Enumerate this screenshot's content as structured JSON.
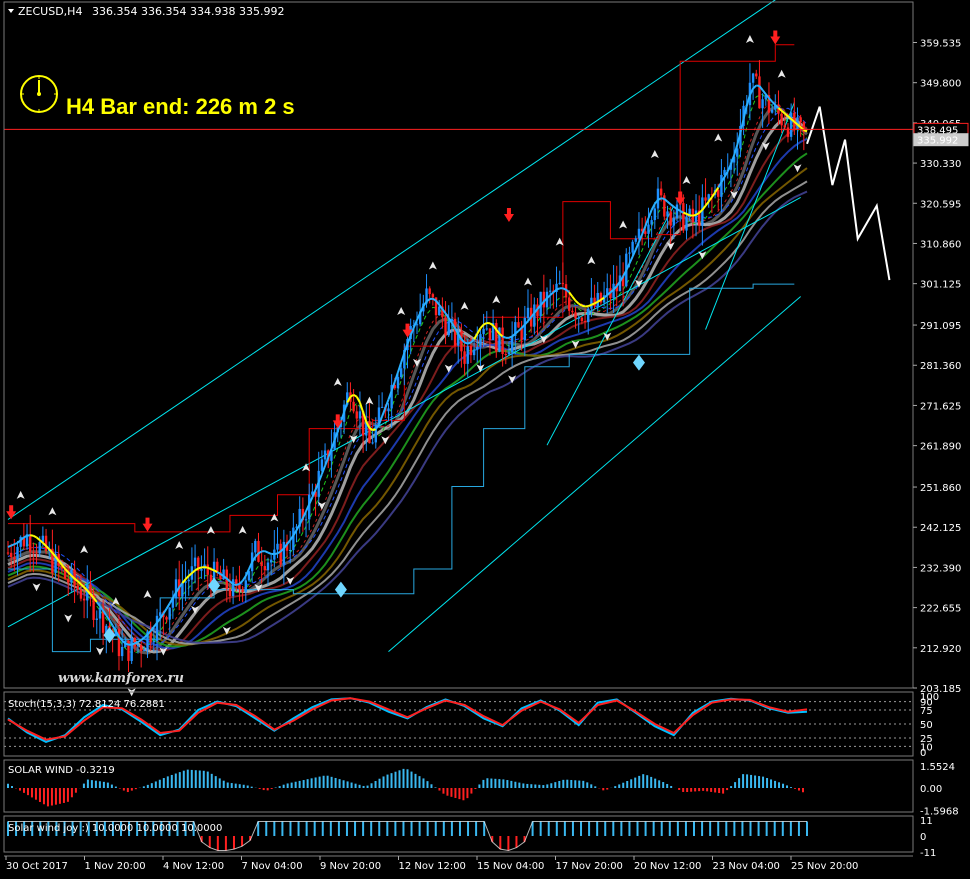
{
  "header": {
    "symbol": "ZECUSD,H4",
    "ohlc": "336.354 336.354 334.938 335.992",
    "timer": "H4 Bar end: 226 m 2 s",
    "watermark": "www.kamforex.ru"
  },
  "colors": {
    "background": "#000000",
    "bull": "#1e90ff",
    "bear": "#ff2020",
    "channel": "#00e5ee",
    "donchian_upper": "#e00000",
    "donchian_lower": "#28a8e0",
    "yellow": "#ffff00",
    "projection": "#ffffff"
  },
  "chart_data": [
    {
      "type": "candlestick",
      "name": "main",
      "ylim": [
        203.185,
        364.5
      ],
      "y_ticks": [
        "359.535",
        "349.800",
        "340.065",
        "330.330",
        "320.595",
        "310.860",
        "301.125",
        "291.095",
        "281.360",
        "271.625",
        "261.890",
        "251.860",
        "242.125",
        "232.390",
        "222.655",
        "212.920",
        "203.185"
      ],
      "price_lines": [
        {
          "label": "338.495",
          "value": 338.495,
          "color": "#ff2020"
        },
        {
          "label": "335.992",
          "value": 335.992,
          "color": "#cccccc"
        }
      ],
      "x_labels": [
        "30 Oct 2017",
        "1 Nov 20:00",
        "4 Nov 12:00",
        "7 Nov 04:00",
        "9 Nov 20:00",
        "12 Nov 12:00",
        "15 Nov 04:00",
        "17 Nov 20:00",
        "20 Nov 12:00",
        "23 Nov 04:00",
        "25 Nov 20:00"
      ],
      "close_path": [
        [
          0,
          236
        ],
        [
          6,
          240
        ],
        [
          12,
          236
        ],
        [
          18,
          230
        ],
        [
          24,
          226
        ],
        [
          30,
          220
        ],
        [
          36,
          212
        ],
        [
          42,
          214
        ],
        [
          48,
          220
        ],
        [
          54,
          228
        ],
        [
          60,
          232
        ],
        [
          66,
          230
        ],
        [
          72,
          226
        ],
        [
          78,
          236
        ],
        [
          84,
          234
        ],
        [
          90,
          240
        ],
        [
          96,
          250
        ],
        [
          102,
          262
        ],
        [
          108,
          276
        ],
        [
          114,
          262
        ],
        [
          120,
          274
        ],
        [
          126,
          288
        ],
        [
          132,
          298
        ],
        [
          138,
          292
        ],
        [
          144,
          284
        ],
        [
          150,
          292
        ],
        [
          156,
          286
        ],
        [
          162,
          290
        ],
        [
          168,
          296
        ],
        [
          174,
          300
        ],
        [
          180,
          294
        ],
        [
          186,
          296
        ],
        [
          192,
          300
        ],
        [
          198,
          310
        ],
        [
          204,
          322
        ],
        [
          210,
          318
        ],
        [
          216,
          316
        ],
        [
          222,
          322
        ],
        [
          228,
          330
        ],
        [
          234,
          350
        ],
        [
          240,
          344
        ],
        [
          246,
          340
        ],
        [
          252,
          336
        ]
      ],
      "upper_band": [
        [
          0,
          243
        ],
        [
          25,
          243
        ],
        [
          40,
          241
        ],
        [
          60,
          241
        ],
        [
          70,
          245
        ],
        [
          85,
          250
        ],
        [
          95,
          266
        ],
        [
          115,
          268
        ],
        [
          125,
          286
        ],
        [
          150,
          293
        ],
        [
          175,
          321
        ],
        [
          190,
          312
        ],
        [
          205,
          313
        ],
        [
          212,
          355
        ],
        [
          232,
          355
        ],
        [
          242,
          359
        ],
        [
          248,
          359
        ]
      ],
      "lower_band": [
        [
          0,
          232
        ],
        [
          14,
          212
        ],
        [
          26,
          215
        ],
        [
          48,
          225
        ],
        [
          65,
          227
        ],
        [
          90,
          226
        ],
        [
          110,
          226
        ],
        [
          128,
          232
        ],
        [
          140,
          252
        ],
        [
          150,
          266
        ],
        [
          163,
          281
        ],
        [
          177,
          284
        ],
        [
          196,
          284
        ],
        [
          215,
          300
        ],
        [
          235,
          301
        ],
        [
          248,
          301
        ]
      ],
      "projection": [
        [
          252,
          335
        ],
        [
          256,
          344
        ],
        [
          260,
          325
        ],
        [
          264,
          336
        ],
        [
          268,
          312
        ],
        [
          274,
          320
        ],
        [
          278,
          302
        ]
      ],
      "up_arrows": [
        [
          1,
          246
        ],
        [
          44,
          243
        ],
        [
          104,
          268
        ],
        [
          126,
          290
        ],
        [
          158,
          318
        ],
        [
          212,
          322
        ],
        [
          242,
          361
        ]
      ],
      "down_arrows": [
        [
          32,
          216
        ],
        [
          65,
          228
        ],
        [
          105,
          227
        ],
        [
          199,
          282
        ]
      ]
    },
    {
      "type": "line",
      "name": "stochastic",
      "title": "Stoch(15,3,3) 72.8124 76.2881",
      "ylim": [
        0,
        100
      ],
      "y_ticks": [
        "100",
        "90",
        "75",
        "50",
        "25",
        "10",
        "0"
      ],
      "series": [
        {
          "name": "main",
          "color": "#00bfff",
          "values": [
            60,
            35,
            18,
            30,
            62,
            84,
            76,
            54,
            30,
            40,
            75,
            90,
            82,
            60,
            38,
            60,
            80,
            94,
            96,
            88,
            72,
            60,
            80,
            94,
            82,
            60,
            46,
            78,
            92,
            74,
            48,
            88,
            94,
            70,
            46,
            30,
            70,
            90,
            95,
            92,
            78,
            70,
            72
          ]
        },
        {
          "name": "signal",
          "color": "#ff2020",
          "values": [
            58,
            38,
            22,
            28,
            56,
            80,
            78,
            58,
            34,
            38,
            70,
            88,
            84,
            64,
            40,
            56,
            76,
            92,
            96,
            90,
            76,
            62,
            78,
            92,
            84,
            64,
            48,
            74,
            90,
            76,
            52,
            84,
            92,
            72,
            50,
            34,
            66,
            88,
            94,
            93,
            80,
            72,
            76
          ]
        }
      ]
    },
    {
      "type": "bar",
      "name": "solar-wind",
      "title": "SOLAR WIND -0.3219",
      "ylim": [
        -1.5968,
        1.5524
      ],
      "y_ticks": [
        "1.5524",
        "0.00",
        "-1.5968"
      ],
      "values": [
        0.3,
        -0.5,
        -1.3,
        -1.0,
        0.6,
        0.4,
        -0.3,
        0.2,
        0.8,
        1.3,
        1.2,
        0.4,
        0.2,
        -0.2,
        0.3,
        0.6,
        0.9,
        0.5,
        0.1,
        0.9,
        1.4,
        0.6,
        -0.5,
        -0.9,
        0.7,
        0.6,
        0.3,
        0.2,
        0.6,
        0.5,
        -0.2,
        0.4,
        1.0,
        0.4,
        -0.3,
        -0.2,
        -0.4,
        1.0,
        0.8,
        0.3,
        -0.3
      ]
    },
    {
      "type": "bar",
      "name": "solar-wind-joy",
      "title": "Solar wind joy :) 10.0000 10.0000 10.0000",
      "ylim": [
        -11,
        11
      ],
      "y_ticks": [
        "11",
        "0",
        "-11"
      ],
      "values": [
        10,
        10,
        10,
        10,
        10,
        10,
        10,
        10,
        10,
        10,
        10,
        10,
        10,
        10,
        10,
        10,
        10,
        10,
        10,
        10,
        10,
        10,
        10,
        10,
        -4,
        -8,
        -10,
        -10,
        -9,
        -7,
        -3,
        10,
        10,
        10,
        10,
        10,
        10,
        10,
        10,
        10,
        10,
        10,
        10,
        10,
        10,
        10,
        10,
        10,
        10,
        10,
        10,
        10,
        10,
        10,
        10,
        10,
        10,
        10,
        10,
        10,
        -4,
        -9,
        -10,
        -8,
        -4,
        10,
        10,
        10,
        10,
        10,
        10,
        10,
        10,
        10,
        10,
        10,
        10,
        10,
        10,
        10,
        10,
        10,
        10,
        10,
        10,
        10,
        10,
        10,
        10,
        10,
        10,
        10,
        10,
        10,
        10,
        10,
        10,
        10,
        10,
        10
      ]
    }
  ]
}
